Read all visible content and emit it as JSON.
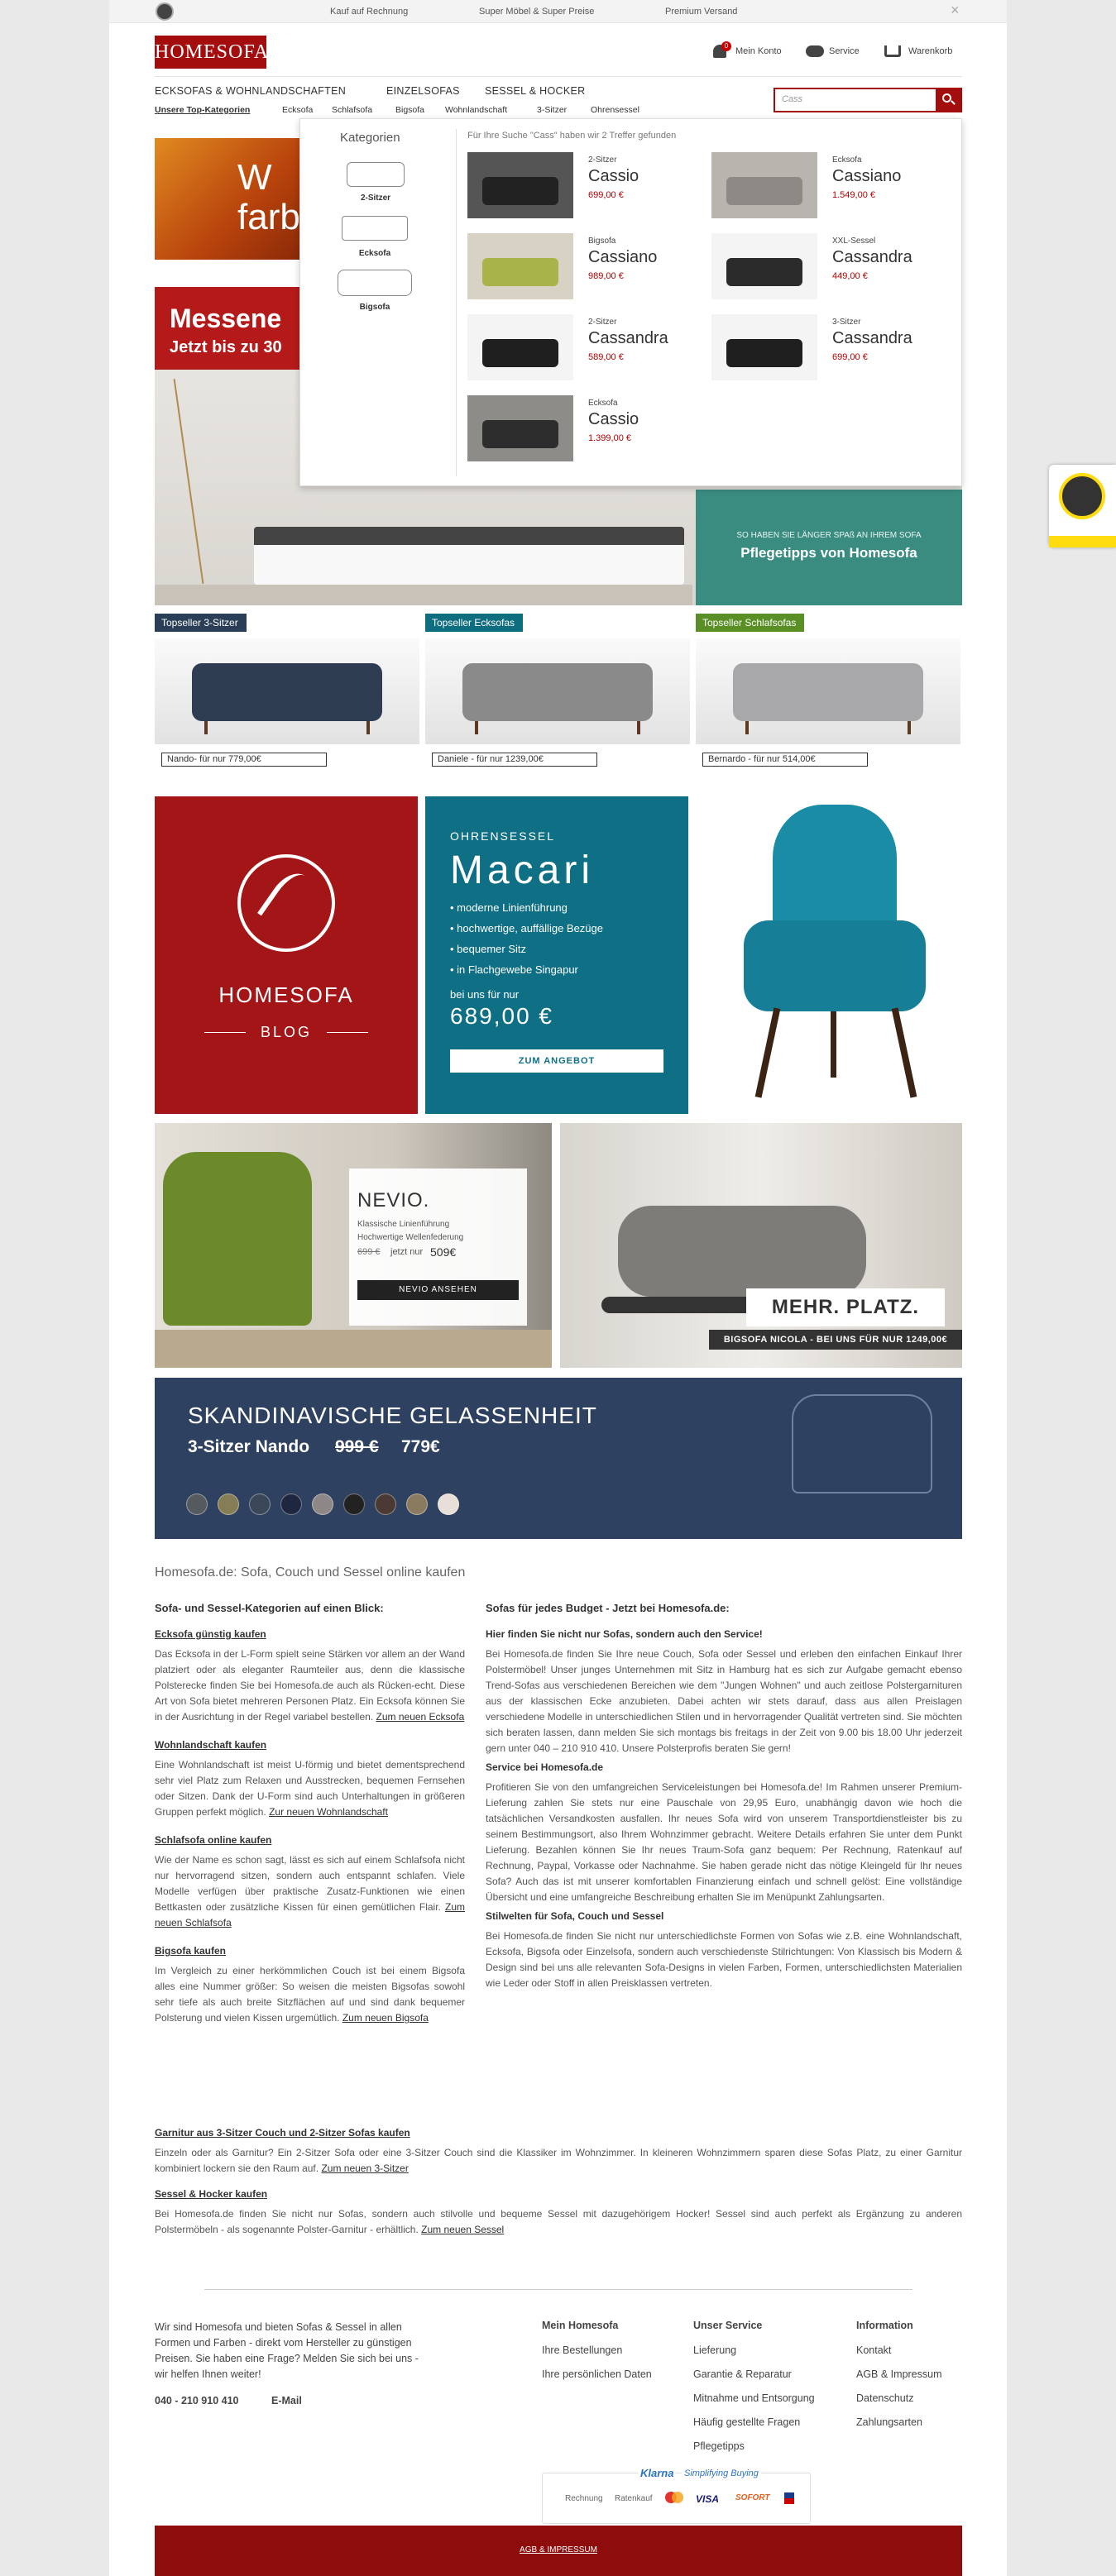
{
  "topbar": {
    "items": [
      "Kauf auf Rechnung",
      "Super Möbel & Super Preise",
      "Premium Versand"
    ],
    "close": "×"
  },
  "header": {
    "logo": "HOMESOFA",
    "links": [
      "Mein Konto",
      "Service",
      "Warenkorb"
    ],
    "cart_count": "0"
  },
  "nav": {
    "main": [
      "ECKSOFAS & WOHNLANDSCHAFTEN",
      "EINZELSOFAS",
      "SESSEL & HOCKER"
    ],
    "sub": [
      "Unsere Top-Kategorien",
      "Ecksofa",
      "Schlafsofa",
      "Bigsofa",
      "Wohnlandschaft",
      "3-Sitzer",
      "Ohrensessel"
    ]
  },
  "search": {
    "value": "Cass"
  },
  "dropdown": {
    "heading": "Kategorien",
    "categories": [
      "2-Sitzer",
      "Ecksofa",
      "Bigsofa"
    ],
    "result_text": "Für Ihre Suche \"Cass\" haben wir 2 Treffer gefunden",
    "results": [
      {
        "cat": "2-Sitzer",
        "name": "Cassio",
        "price": "699,00 €"
      },
      {
        "cat": "Ecksofa",
        "name": "Cassiano",
        "price": "1.549,00 €"
      },
      {
        "cat": "Bigsofa",
        "name": "Cassiano",
        "price": "989,00 €"
      },
      {
        "cat": "XXL-Sessel",
        "name": "Cassandra",
        "price": "449,00 €"
      },
      {
        "cat": "2-Sitzer",
        "name": "Cassandra",
        "price": "589,00 €"
      },
      {
        "cat": "3-Sitzer",
        "name": "Cassandra",
        "price": "699,00 €"
      },
      {
        "cat": "Ecksofa",
        "name": "Cassio",
        "price": "1.399,00 €"
      }
    ]
  },
  "hero": {
    "banner_text": "W farb",
    "sale_line1": "Messene",
    "sale_line2": "Jetzt bis zu 30",
    "care_kicker": "SO HABEN SIE LÄNGER SPAß AN IHREM SOFA",
    "care_title": "Pflegetipps von Homesofa"
  },
  "topseller": [
    {
      "tag": "Topseller 3-Sitzer",
      "tag_color": "#2b3e57",
      "price": "Nando- für nur 779,00€",
      "sofa": "#2f3d52"
    },
    {
      "tag": "Topseller Ecksofas",
      "tag_color": "#0f6d80",
      "price": "Daniele - für nur 1239,00€",
      "sofa": "#8a8a8a"
    },
    {
      "tag": "Topseller Schlafsofas",
      "tag_color": "#5a8f26",
      "price": "Bernardo - für nur 514,00€",
      "sofa": "#a8a8ab"
    }
  ],
  "blog": {
    "brand": "HOMESOFA",
    "label": "BLOG"
  },
  "macari": {
    "kicker": "OHRENSESSEL",
    "title": "Macari",
    "bullets": [
      "moderne Linienführung",
      "hochwertige, auffällige Bezüge",
      "bequemer Sitz",
      "in Flachgewebe Singapur"
    ],
    "price_label": "bei uns für nur",
    "price": "689,00 €",
    "button": "ZUM ANGEBOT"
  },
  "nevio": {
    "title": "NEVIO.",
    "line1": "Klassische Linienführung",
    "line2": "Hochwertige Wellenfederung",
    "old_price": "699 €",
    "mid": "jetzt nur",
    "price": "509€",
    "button": "NEVIO ANSEHEN"
  },
  "nicola": {
    "headline": "MEHR. PLATZ.",
    "caption": "BIGSOFA NICOLA - BEI UNS FÜR NUR 1249,00€"
  },
  "nando": {
    "title": "SKANDINAVISCHE GELASSENHEIT",
    "sub": "3-Sitzer Nando",
    "old": "999 €",
    "price": "779€",
    "swatches": [
      "#555a5e",
      "#857d55",
      "#3a4759",
      "#1f2740",
      "#8d8887",
      "#222",
      "#4a3a33",
      "#8a7a60",
      "#e8e0d8"
    ]
  },
  "seo": {
    "title": "Homesofa.de: Sofa, Couch und Sessel online kaufen",
    "left_heading": "Sofa- und Sessel-Kategorien auf einen Blick:",
    "left": [
      {
        "h": "Ecksofa günstig kaufen",
        "p": "Das Ecksofa in der L-Form spielt seine Stärken vor allem an der Wand platziert oder als eleganter Raumteiler aus, denn die klassische Polsterecke finden Sie bei Homesofa.de auch als Rücken-echt. Diese Art von Sofa bietet mehreren Personen Platz. Ein Ecksofa können Sie in der Ausrichtung in der Regel variabel bestellen.",
        "l": "Zum neuen Ecksofa"
      },
      {
        "h": "Wohnlandschaft kaufen",
        "p": "Eine Wohnlandschaft ist meist U-förmig und bietet dementsprechend sehr viel Platz zum Relaxen und Ausstrecken, bequemen Fernsehen oder Sitzen. Dank der U-Form sind auch Unterhaltungen in größeren Gruppen perfekt möglich.",
        "l": "Zur neuen Wohnlandschaft"
      },
      {
        "h": "Schlafsofa online kaufen",
        "p": "Wie der Name es schon sagt, lässt es sich auf einem Schlafsofa nicht nur hervorragend sitzen, sondern auch entspannt schlafen. Viele Modelle verfügen über praktische Zusatz-Funktionen wie einen Bettkasten oder zusätzliche Kissen für einen gemütlichen Flair.",
        "l": "Zum neuen Schlafsofa"
      },
      {
        "h": "Bigsofa kaufen",
        "p": "Im Vergleich zu einer herkömmlichen Couch ist bei einem Bigsofa alles eine Nummer größer: So weisen die meisten Bigsofas sowohl sehr tiefe als auch breite Sitzflächen auf und sind dank bequemer Polsterung und vielen Kissen urgemütlich.",
        "l": "Zum neuen Bigsofa"
      }
    ],
    "right_heading": "Sofas für jedes Budget - Jetzt bei Homesofa.de:",
    "right_sub": "Hier finden Sie nicht nur Sofas, sondern auch den Service!",
    "right_p1": "Bei Homesofa.de finden Sie Ihre neue Couch, Sofa oder Sessel und erleben den einfachen Einkauf Ihrer Polstermöbel! Unser junges Unternehmen mit Sitz in Hamburg hat es sich zur Aufgabe gemacht ebenso Trend-Sofas aus verschiedenen Bereichen wie dem \"Jungen Wohnen\" und auch zeitlose Polstergarnituren aus der klassischen Ecke anzubieten. Dabei achten wir stets darauf, dass aus allen Preislagen verschiedene Modelle in unterschiedlichen Stilen und in hervorragender Qualität vertreten sind. Sie möchten sich beraten lassen, dann melden Sie sich montags bis freitags in der Zeit von 9.00 bis 18.00 Uhr jederzeit gern unter 040 – 210 910 410. Unsere Polsterprofis beraten Sie gern!",
    "right_h2": "Service bei Homesofa.de",
    "right_p2": "Profitieren Sie von den umfangreichen Serviceleistungen bei Homesofa.de! Im Rahmen unserer Premium-Lieferung zahlen Sie stets nur eine Pauschale von 29,95 Euro, unabhängig davon wie hoch die tatsächlichen Versandkosten ausfallen. Ihr neues Sofa wird von unserem Transportdienstleister bis zu seinem Bestimmungsort, also Ihrem Wohnzimmer gebracht. Weitere Details erfahren Sie unter dem Punkt Lieferung. Bezahlen können Sie Ihr neues Traum-Sofa ganz bequem: Per Rechnung, Ratenkauf auf Rechnung, Paypal, Vorkasse oder Nachnahme. Sie haben gerade nicht das nötige Kleingeld für Ihr neues Sofa? Auch das ist mit unserer komfortablen Finanzierung einfach und schnell gelöst: Eine vollständige Übersicht und eine umfangreiche Beschreibung erhalten Sie im Menüpunkt Zahlungsarten.",
    "right_h3": "Stilwelten für Sofa, Couch und Sessel",
    "right_p3": "Bei Homesofa.de finden Sie nicht nur unterschiedlichste Formen von Sofas wie z.B. eine Wohnlandschaft, Ecksofa, Bigsofa oder Einzelsofa, sondern auch verschiedenste Stilrichtungen: Von Klassisch bis Modern & Design sind bei uns alle relevanten Sofa-Designs in vielen Farben, Formen, unterschiedlichsten Materialien wie Leder oder Stoff in allen Preisklassen vertreten.",
    "garnitur_h": "Garnitur aus 3-Sitzer Couch und 2-Sitzer Sofas kaufen",
    "garnitur_p": "Einzeln oder als Garnitur? Ein 2-Sitzer Sofa oder eine 3-Sitzer Couch sind die Klassiker im Wohnzimmer. In kleineren Wohnzimmern sparen diese Sofas Platz, zu einer Garnitur kombiniert lockern sie den Raum auf.",
    "garnitur_l": "Zum neuen 3-Sitzer",
    "sessel_h": "Sessel & Hocker kaufen",
    "sessel_p": "Bei Homesofa.de finden Sie nicht nur Sofas, sondern auch stilvolle und bequeme Sessel mit dazugehörigem Hocker! Sessel sind auch perfekt als Ergänzung zu anderen Polstermöbeln - als sogenannte Polster-Garnitur - erhältlich.",
    "sessel_l": "Zum neuen Sessel"
  },
  "footer": {
    "about": "Wir sind Homesofa und bieten Sofas & Sessel in allen Formen und Farben - direkt vom Hersteller zu günstigen Preisen. Sie haben eine Frage? Melden Sie sich bei uns - wir helfen Ihnen weiter!",
    "phone": "040 - 210 910 410",
    "email": "E-Mail",
    "cols": [
      {
        "h": "Mein Homesofa",
        "items": [
          "Ihre Bestellungen",
          "Ihre persönlichen Daten"
        ]
      },
      {
        "h": "Unser Service",
        "items": [
          "Lieferung",
          "Garantie & Reparatur",
          "Mitnahme und Entsorgung",
          "Häufig gestellte Fragen",
          "Pflegetipps"
        ]
      },
      {
        "h": "Information",
        "items": [
          "Kontakt",
          "AGB & Impressum",
          "Datenschutz",
          "Zahlungsarten"
        ]
      }
    ],
    "klarna": "Klarna",
    "klarna_tag": "Simplifying Buying",
    "payments": [
      "Rechnung",
      "Ratenkauf",
      "",
      "VISA",
      "SOFORT"
    ],
    "bottom": "AGB & IMPRESSUM"
  }
}
